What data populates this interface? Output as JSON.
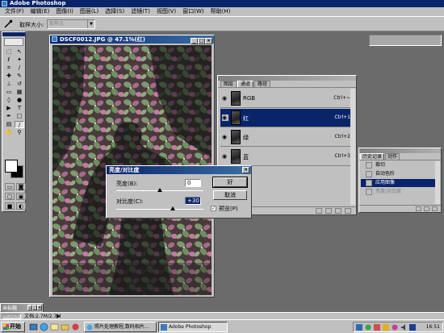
{
  "app": {
    "title": "Adobe Photoshop"
  },
  "menu": [
    "文件(F)",
    "编辑(E)",
    "图像(I)",
    "图层(L)",
    "选择(S)",
    "滤镜(T)",
    "视图(V)",
    "窗口(W)",
    "帮助(H)"
  ],
  "options": {
    "label": "取样大小:",
    "select_value": "取样点"
  },
  "document": {
    "title": "DSCF0012.JPG @ 47.1%(红)"
  },
  "channels_palette": {
    "tabs": [
      "图层",
      "通道",
      "路径"
    ],
    "active_tab": 1,
    "rows": [
      {
        "name": "RGB",
        "shortcut": "Ctrl+~",
        "selected": false
      },
      {
        "name": "红",
        "shortcut": "Ctrl+1",
        "selected": true
      },
      {
        "name": "绿",
        "shortcut": "Ctrl+2",
        "selected": false
      },
      {
        "name": "蓝",
        "shortcut": "Ctrl+3",
        "selected": false
      }
    ]
  },
  "history_palette": {
    "tabs": [
      "历史记录",
      "动作"
    ],
    "rows": [
      {
        "label": "裁切",
        "state": "normal"
      },
      {
        "label": "自动色阶",
        "state": "normal"
      },
      {
        "label": "应用图像",
        "state": "selected"
      },
      {
        "label": "亮度/对比度",
        "state": "dim"
      }
    ]
  },
  "dialog": {
    "title": "亮度/对比度",
    "brightness_label": "亮度(B):",
    "brightness_value": "0",
    "contrast_label": "对比度(C):",
    "contrast_value": "+30",
    "contrast_level": 30,
    "brightness_level": 0,
    "ok": "好",
    "cancel": "取消",
    "preview_label": "预览(P)",
    "preview_checked": true
  },
  "minimized_doc": {
    "title": "未标题"
  },
  "status": {
    "zoom": "47.11%",
    "doc": "文档:2.7M/2.7M"
  },
  "taskbar": {
    "start": "开始",
    "tasks": [
      {
        "label": "照片处理教程,数码相片...",
        "active": false
      },
      {
        "label": "Adobe Photoshop",
        "active": true
      }
    ],
    "time": "16:51"
  },
  "colors": {
    "title_blue": "#0a246a",
    "face": "#c0c0c0",
    "workspace": "#6b6b6b"
  }
}
